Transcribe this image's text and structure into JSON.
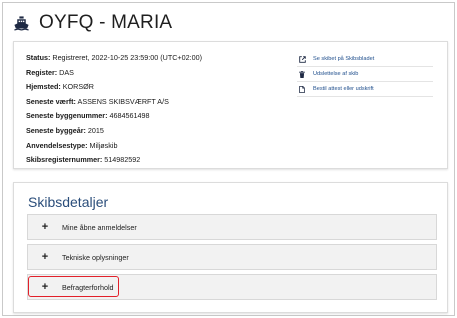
{
  "header": {
    "title": "OYFQ - MARIA",
    "icon": "ship-icon"
  },
  "info": {
    "rows": [
      {
        "label": "Status:",
        "value": " Registreret, 2022-10-25 23:59:00 (UTC+02:00)"
      },
      {
        "label": "Register:",
        "value": " DAS"
      },
      {
        "label": "Hjemsted:",
        "value": " KORSØR"
      },
      {
        "label": "Seneste værft:",
        "value": " ASSENS SKIBSVÆRFT A/S"
      },
      {
        "label": "Seneste byggenummer:",
        "value": " 4684561498"
      },
      {
        "label": "Seneste byggeår:",
        "value": " 2015"
      },
      {
        "label": "Anvendelsestype:",
        "value": " Miljøskib"
      },
      {
        "label": "Skibsregisternummer:",
        "value": " 514982592"
      }
    ],
    "actions": [
      {
        "label": "Se skibet på Skibsbladet",
        "icon": "external-link-icon"
      },
      {
        "label": "Udslettelse af skib",
        "icon": "trash-icon"
      },
      {
        "label": "Bestil attest eller udskrift",
        "icon": "document-icon"
      }
    ]
  },
  "details": {
    "title": "Skibsdetaljer",
    "accordions": [
      {
        "label": "Mine åbne anmeldelser",
        "icon": "plus-icon",
        "symbol": "+"
      },
      {
        "label": "Tekniske oplysninger",
        "icon": "plus-icon",
        "symbol": "+"
      },
      {
        "label": "Befragterforhold",
        "icon": "plus-icon",
        "symbol": "+"
      }
    ]
  },
  "colors": {
    "link": "#1f4e8c",
    "section_title": "#2a4d7a",
    "highlight": "#e2202a",
    "accordion_bg": "#f2f2f2"
  }
}
